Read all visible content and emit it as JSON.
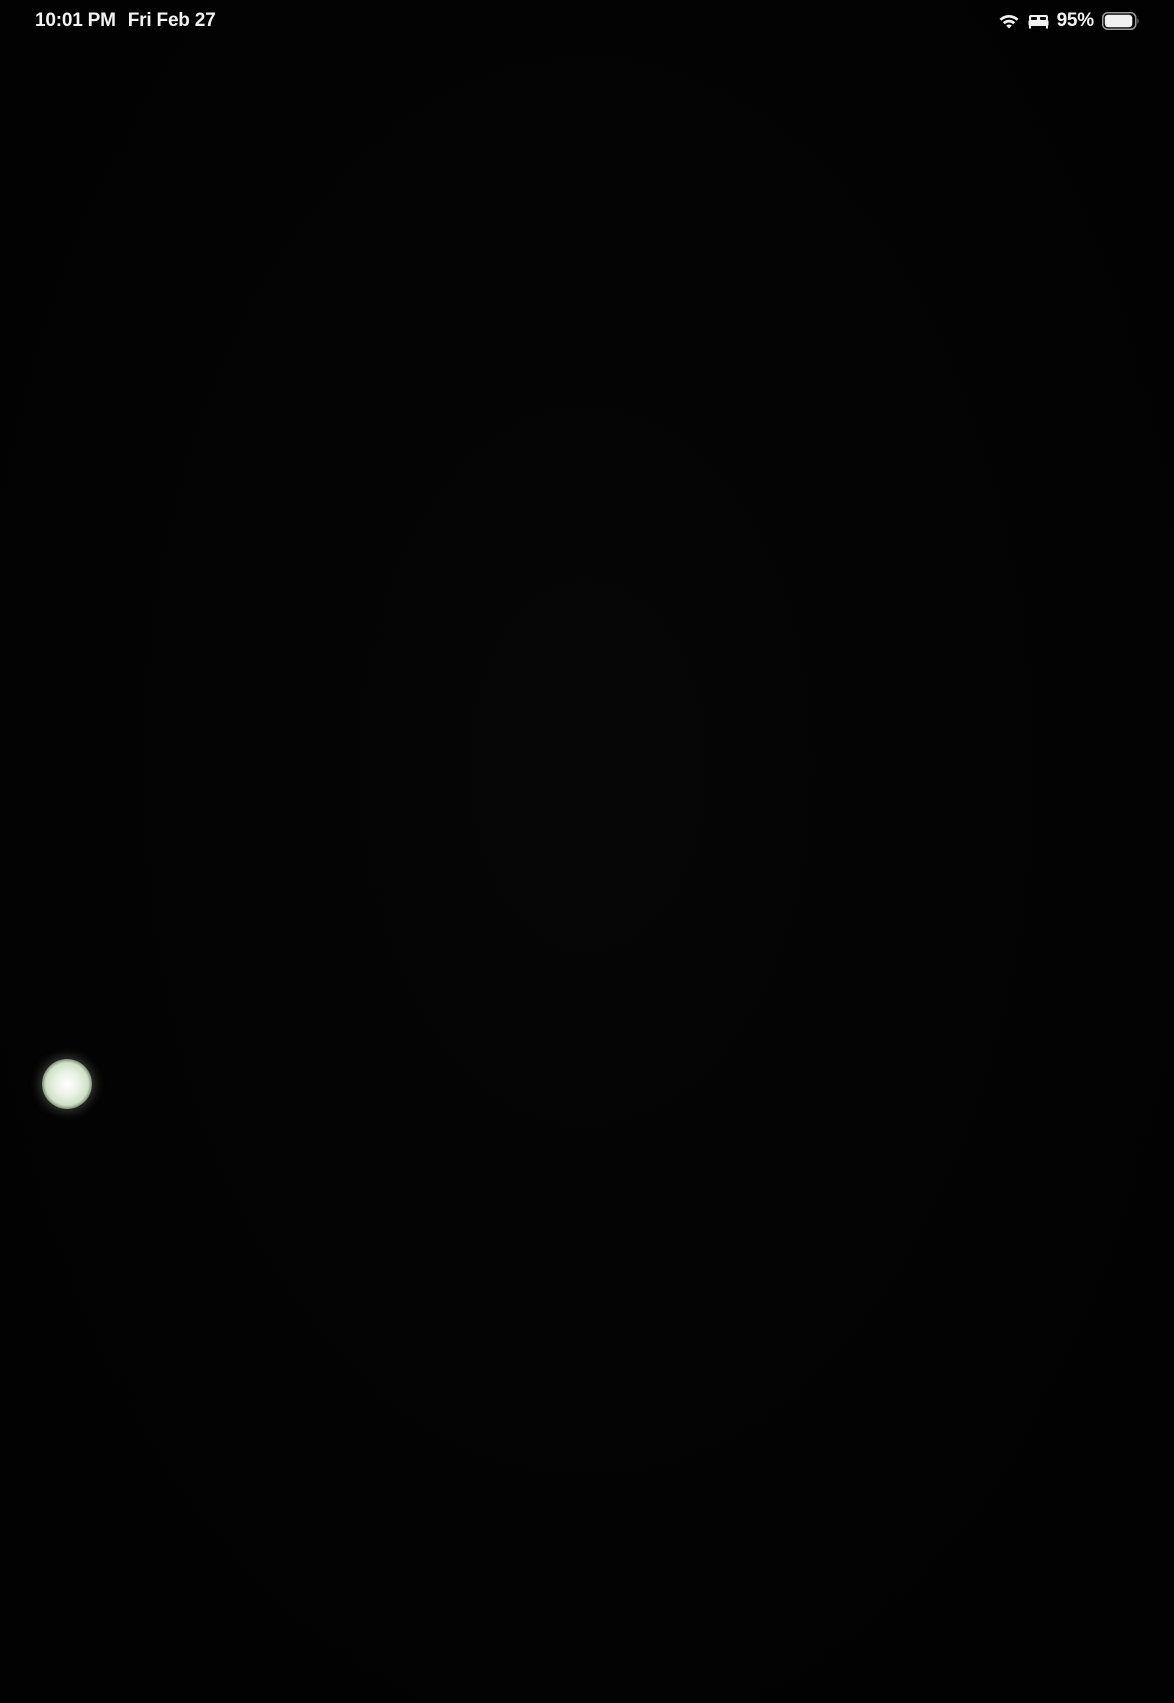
{
  "status_bar": {
    "time": "10:01 PM",
    "date": "Fri Feb 27",
    "battery_percent": "95%",
    "battery_level": 0.95,
    "icons": [
      "wifi-icon",
      "sleep-focus-icon",
      "battery-icon"
    ]
  },
  "colors": {
    "background": "#030303",
    "status_text": "#f2f2f2",
    "light_dot": "#e9f1e4"
  }
}
